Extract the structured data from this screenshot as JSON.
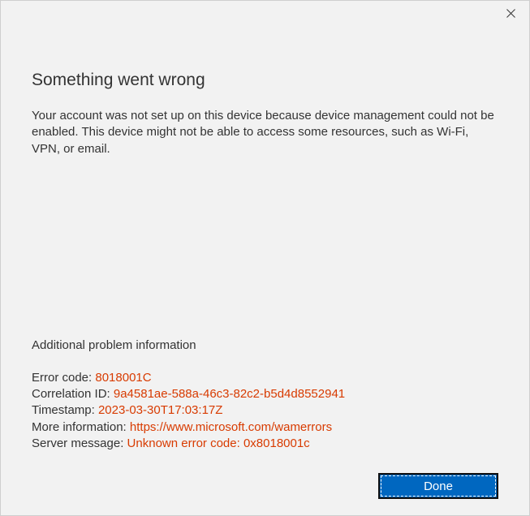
{
  "heading": "Something went wrong",
  "description": "Your account was not set up on this device because device management could not be enabled. This device might not be able to access some resources, such as Wi-Fi, VPN, or email.",
  "additional_heading": "Additional problem information",
  "info": {
    "error_code_label": "Error code: ",
    "error_code_value": "8018001C",
    "correlation_label": "Correlation ID: ",
    "correlation_value": "9a4581ae-588a-46c3-82c2-b5d4d8552941",
    "timestamp_label": "Timestamp: ",
    "timestamp_value": "2023-03-30T17:03:17Z",
    "more_info_label": "More information: ",
    "more_info_value": "https://www.microsoft.com/wamerrors",
    "server_msg_label": "Server message: ",
    "server_msg_value": "Unknown error code: 0x8018001c"
  },
  "done_label": "Done"
}
